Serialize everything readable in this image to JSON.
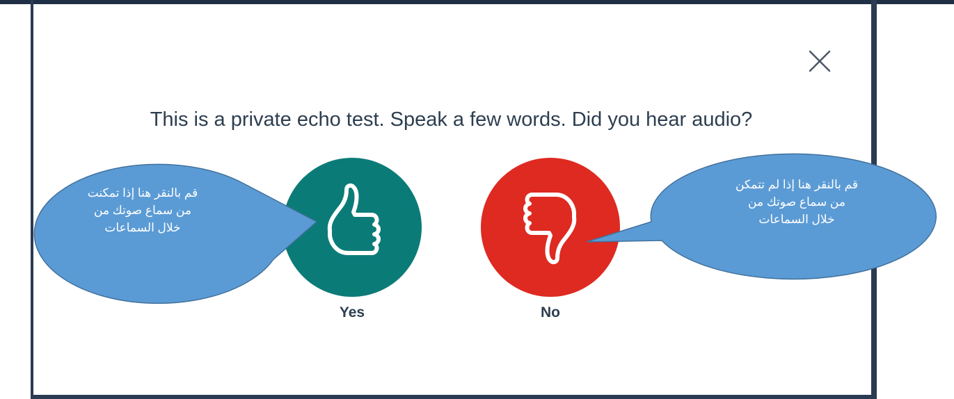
{
  "dialog": {
    "question": "This is a private echo test. Speak a few words. Did you hear audio?",
    "close_icon": "close-icon"
  },
  "buttons": {
    "yes": {
      "label": "Yes",
      "icon": "thumbs-up-icon",
      "color": "#0b7b78"
    },
    "no": {
      "label": "No",
      "icon": "thumbs-down-icon",
      "color": "#de2a21"
    }
  },
  "callouts": {
    "yes": {
      "text": "قم بالنقر هنا إذا تمكنت\nمن سماع صوتك من\nخلال السماعات",
      "color": "#5b9bd5"
    },
    "no": {
      "text": "قم بالنقر هنا إذا لم تتمكن\nمن سماع صوتك من\nخلال السماعات",
      "color": "#5b9bd5"
    }
  }
}
